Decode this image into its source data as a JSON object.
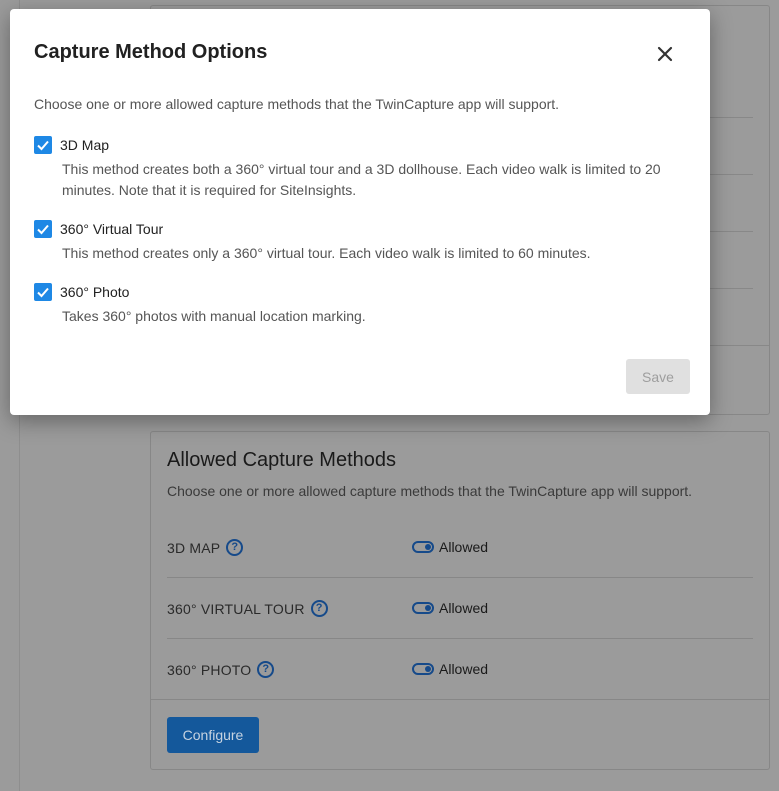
{
  "modal": {
    "title": "Capture Method Options",
    "description": "Choose one or more allowed capture methods that the TwinCapture app will support.",
    "options": [
      {
        "label": "3D Map",
        "checked": true,
        "description": "This method creates both a 360° virtual tour and a 3D dollhouse. Each video walk is limited to 20 minutes. Note that it is required for SiteInsights."
      },
      {
        "label": "360° Virtual Tour",
        "checked": true,
        "description": "This method creates only a 360° virtual tour. Each video walk is limited to 60 minutes."
      },
      {
        "label": "360° Photo",
        "checked": true,
        "description": "Takes 360° photos with manual location marking."
      }
    ],
    "save_label": "Save",
    "close_icon": "close-icon"
  },
  "card": {
    "title": "Allowed Capture Methods",
    "description": "Choose one or more allowed capture methods that the TwinCapture app will support.",
    "methods": [
      {
        "label": "3D MAP",
        "status": "Allowed"
      },
      {
        "label": "360° VIRTUAL TOUR",
        "status": "Allowed"
      },
      {
        "label": "360° PHOTO",
        "status": "Allowed"
      }
    ],
    "configure_label": "Configure"
  },
  "colors": {
    "accent": "#1e88e5",
    "primary_button": "#1976d2",
    "overlay": "#9b9b9b"
  }
}
